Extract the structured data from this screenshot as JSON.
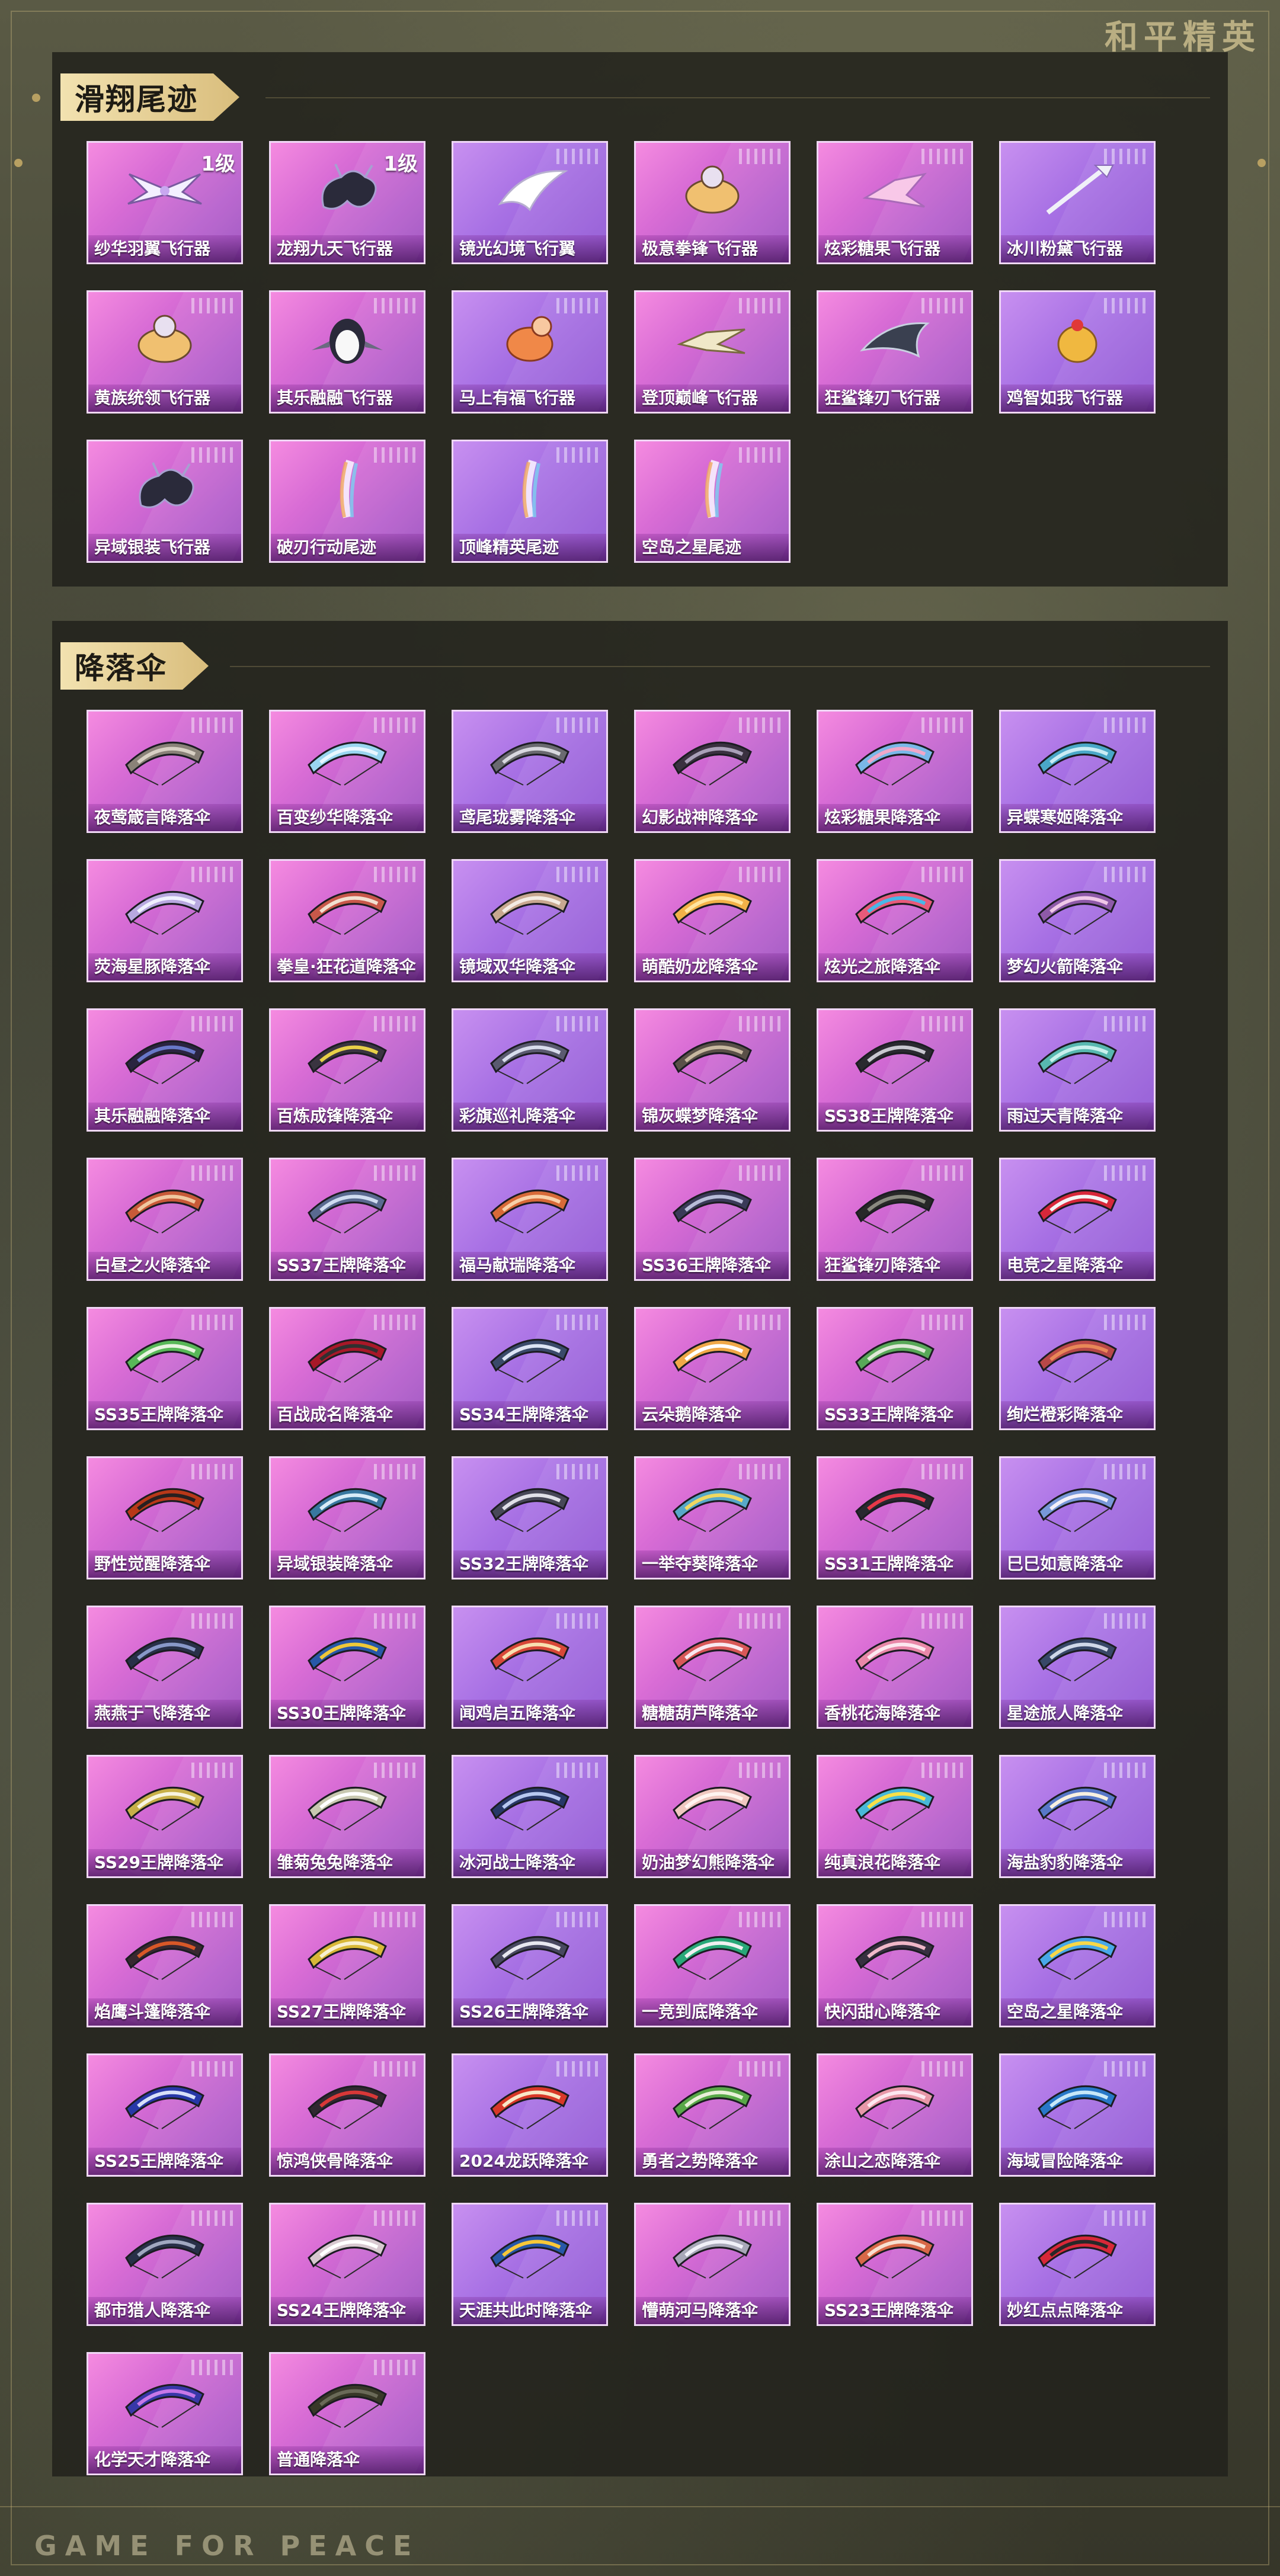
{
  "brand_logo_text": "和平精英",
  "footer_text": "GAME FOR PEACE",
  "colors": {
    "accent_gold": "#d9bd7c",
    "card_pink": "#d86cd5",
    "card_violet": "#a770e4"
  },
  "sections": {
    "glide": {
      "title": "滑翔尾迹",
      "items": [
        {
          "name": "纱华羽翼飞行器",
          "badge": "1级",
          "icon": "winged-glider-icon"
        },
        {
          "name": "龙翔九天飞行器",
          "badge": "1级",
          "icon": "dragon-glider-icon"
        },
        {
          "name": "镜光幻境飞行翼",
          "icon": "wing-glider-icon"
        },
        {
          "name": "极意拳锋飞行器",
          "icon": "creature-glider-icon"
        },
        {
          "name": "炫彩糖果飞行器",
          "icon": "candy-glider-icon"
        },
        {
          "name": "冰川粉黛飞行器",
          "icon": "trident-glider-icon"
        },
        {
          "name": "黄族统领飞行器",
          "icon": "creature-glider-icon"
        },
        {
          "name": "其乐融融飞行器",
          "icon": "penguin-glider-icon"
        },
        {
          "name": "马上有福飞行器",
          "icon": "horse-glider-icon"
        },
        {
          "name": "登顶巅峰飞行器",
          "icon": "jet-glider-icon"
        },
        {
          "name": "狂鲨锋刃飞行器",
          "icon": "shark-glider-icon"
        },
        {
          "name": "鸡智如我飞行器",
          "icon": "chicken-glider-icon"
        },
        {
          "name": "异域银装飞行器",
          "icon": "dragon-glider-icon"
        },
        {
          "name": "破刃行动尾迹",
          "icon": "trail-icon"
        },
        {
          "name": "顶峰精英尾迹",
          "icon": "trail-icon"
        },
        {
          "name": "空岛之星尾迹",
          "icon": "trail-icon"
        }
      ]
    },
    "parachute": {
      "title": "降落伞",
      "items": [
        {
          "name": "夜莺箴言降落伞",
          "c1": "#8a8278",
          "c2": "#d8d0c4"
        },
        {
          "name": "百变纱华降落伞",
          "c1": "#9ad6f0",
          "c2": "#e8f6ff"
        },
        {
          "name": "鸢尾珑雾降落伞",
          "c1": "#6a6a70",
          "c2": "#d9d9df"
        },
        {
          "name": "幻影战神降落伞",
          "c1": "#3a3140",
          "c2": "#a9a0b8"
        },
        {
          "name": "炫彩糖果降落伞",
          "c1": "#7ab8e8",
          "c2": "#f1a7c8"
        },
        {
          "name": "异蝶寒姬降落伞",
          "c1": "#4aa8c8",
          "c2": "#c9ecf4"
        },
        {
          "name": "荧海星豚降落伞",
          "c1": "#b8a8e0",
          "c2": "#f0f0ff"
        },
        {
          "name": "拳皇·狂花道降落伞",
          "c1": "#c8584a",
          "c2": "#f2e0d0"
        },
        {
          "name": "镜域双华降落伞",
          "c1": "#c8a890",
          "c2": "#f4ece4"
        },
        {
          "name": "萌酷奶龙降落伞",
          "c1": "#f2b248",
          "c2": "#ffe6a0"
        },
        {
          "name": "炫光之旅降落伞",
          "c1": "#e85a7a",
          "c2": "#48b8e8"
        },
        {
          "name": "梦幻火箭降落伞",
          "c1": "#8e5aa8",
          "c2": "#f0c8e8"
        },
        {
          "name": "其乐融融降落伞",
          "c1": "#2a2440",
          "c2": "#6878c8"
        },
        {
          "name": "百炼成锋降落伞",
          "c1": "#3a3440",
          "c2": "#e8d048"
        },
        {
          "name": "彩旗巡礼降落伞",
          "c1": "#5a5a70",
          "c2": "#d8dcec"
        },
        {
          "name": "锦灰蝶梦降落伞",
          "c1": "#5a5048",
          "c2": "#c8b8a0"
        },
        {
          "name": "SS38王牌降落伞",
          "c1": "#2a2a30",
          "c2": "#c8c8d0"
        },
        {
          "name": "雨过天青降落伞",
          "c1": "#58b8b0",
          "c2": "#c8f0ec"
        },
        {
          "name": "白昼之火降落伞",
          "c1": "#c85a38",
          "c2": "#f0c8a0"
        },
        {
          "name": "SS37王牌降落伞",
          "c1": "#5a6a90",
          "c2": "#d0dcf0"
        },
        {
          "name": "福马献瑞降落伞",
          "c1": "#d86a38",
          "c2": "#f8d0a8"
        },
        {
          "name": "SS36王牌降落伞",
          "c1": "#3a3a58",
          "c2": "#b8bcd8"
        },
        {
          "name": "狂鲨锋刃降落伞",
          "c1": "#282828",
          "c2": "#8a8a80"
        },
        {
          "name": "电竞之星降落伞",
          "c1": "#d8283a",
          "c2": "#f4f4f4"
        },
        {
          "name": "SS35王牌降落伞",
          "c1": "#58b858",
          "c2": "#e8f4e0"
        },
        {
          "name": "百战成名降落伞",
          "c1": "#a81828",
          "c2": "#303030"
        },
        {
          "name": "SS34王牌降落伞",
          "c1": "#3a4a6a",
          "c2": "#dce4f4"
        },
        {
          "name": "云朵鹅降落伞",
          "c1": "#f0a848",
          "c2": "#ffffff"
        },
        {
          "name": "SS33王牌降落伞",
          "c1": "#58a858",
          "c2": "#e0e8d8"
        },
        {
          "name": "绚烂橙彩降落伞",
          "c1": "#b84848",
          "c2": "#e88858"
        },
        {
          "name": "野性觉醒降落伞",
          "c1": "#b83818",
          "c2": "#282020"
        },
        {
          "name": "异域银装降落伞",
          "c1": "#3878a0",
          "c2": "#d8ecf8"
        },
        {
          "name": "SS32王牌降落伞",
          "c1": "#484858",
          "c2": "#e0e0e8"
        },
        {
          "name": "一举夺葵降落伞",
          "c1": "#58a8c8",
          "c2": "#f0d860"
        },
        {
          "name": "SS31王牌降落伞",
          "c1": "#282830",
          "c2": "#e83848"
        },
        {
          "name": "巳巳如意降落伞",
          "c1": "#7898d8",
          "c2": "#f4f0f8"
        },
        {
          "name": "燕燕于飞降落伞",
          "c1": "#283048",
          "c2": "#8898c8"
        },
        {
          "name": "SS30王牌降落伞",
          "c1": "#2858a8",
          "c2": "#f0c838"
        },
        {
          "name": "闻鸡启五降落伞",
          "c1": "#d84838",
          "c2": "#f8e0b0"
        },
        {
          "name": "糖糖葫芦降落伞",
          "c1": "#d85858",
          "c2": "#f8e8f0"
        },
        {
          "name": "香桃花海降落伞",
          "c1": "#e888a8",
          "c2": "#fce8f0"
        },
        {
          "name": "星途旅人降落伞",
          "c1": "#384868",
          "c2": "#d0d8e8"
        },
        {
          "name": "SS29王牌降落伞",
          "c1": "#c8b048",
          "c2": "#f8f4e0"
        },
        {
          "name": "雏菊兔兔降落伞",
          "c1": "#c8c8b0",
          "c2": "#ffffff"
        },
        {
          "name": "冰河战士降落伞",
          "c1": "#283868",
          "c2": "#b8c8f0"
        },
        {
          "name": "奶油梦幻熊降落伞",
          "c1": "#f0c8c0",
          "c2": "#fff4f0"
        },
        {
          "name": "纯真浪花降落伞",
          "c1": "#48b8d8",
          "c2": "#f8e048"
        },
        {
          "name": "海盐豹豹降落伞",
          "c1": "#5878c8",
          "c2": "#f8f0e0"
        },
        {
          "name": "焰鹰斗篷降落伞",
          "c1": "#382830",
          "c2": "#d85828"
        },
        {
          "name": "SS27王牌降落伞",
          "c1": "#d8b838",
          "c2": "#f8f0d0"
        },
        {
          "name": "SS26王牌降落伞",
          "c1": "#484860",
          "c2": "#e8e8f0"
        },
        {
          "name": "一竞到底降落伞",
          "c1": "#28a878",
          "c2": "#f0f0f0"
        },
        {
          "name": "快闪甜心降落伞",
          "c1": "#383040",
          "c2": "#f0b8c8"
        },
        {
          "name": "空岛之星降落伞",
          "c1": "#48a8e8",
          "c2": "#f8d848"
        },
        {
          "name": "SS25王牌降落伞",
          "c1": "#2838a8",
          "c2": "#d8e0f8"
        },
        {
          "name": "惊鸿侠骨降落伞",
          "c1": "#302830",
          "c2": "#d83838"
        },
        {
          "name": "2024龙跃降落伞",
          "c1": "#d83828",
          "c2": "#f8e8c8"
        },
        {
          "name": "勇者之势降落伞",
          "c1": "#58a848",
          "c2": "#e8f0d8"
        },
        {
          "name": "涂山之恋降落伞",
          "c1": "#e898a8",
          "c2": "#fce8f0"
        },
        {
          "name": "海域冒险降落伞",
          "c1": "#2878c8",
          "c2": "#c8e8f8"
        },
        {
          "name": "都市猎人降落伞",
          "c1": "#283048",
          "c2": "#a0a8c0"
        },
        {
          "name": "SS24王牌降落伞",
          "c1": "#d8c8d0",
          "c2": "#ffffff"
        },
        {
          "name": "天涯共此时降落伞",
          "c1": "#2858a8",
          "c2": "#f8c838"
        },
        {
          "name": "懵萌河马降落伞",
          "c1": "#a8a8b8",
          "c2": "#f0f0f8"
        },
        {
          "name": "SS23王牌降落伞",
          "c1": "#d86848",
          "c2": "#f8e0d0"
        },
        {
          "name": "妙红点点降落伞",
          "c1": "#d82838",
          "c2": "#282828"
        },
        {
          "name": "化学天才降落伞",
          "c1": "#3838a8",
          "c2": "#c878e8"
        },
        {
          "name": "普通降落伞",
          "c1": "#383828",
          "c2": "#6a6a58"
        }
      ]
    }
  }
}
